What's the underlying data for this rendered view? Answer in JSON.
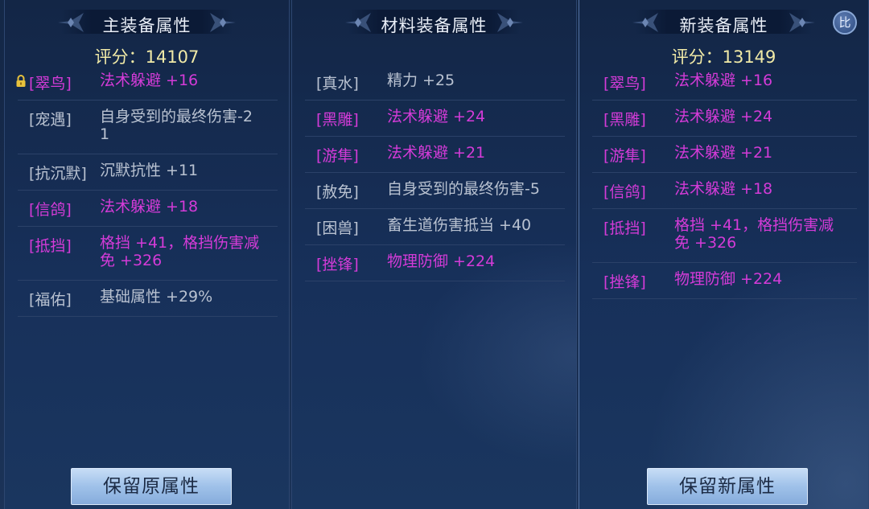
{
  "panels": {
    "main": {
      "title": "主装备属性",
      "score": "评分：14107",
      "button": "保留原属性",
      "attributes": [
        {
          "name": "[翠鸟]",
          "value": "法术躲避 +16",
          "color": "pink",
          "locked": true
        },
        {
          "name": "[宠遇]",
          "value": "自身受到的最终伤害-2\n1",
          "color": "gray"
        },
        {
          "name": "[抗沉默]",
          "value": "沉默抗性 +11",
          "color": "gray"
        },
        {
          "name": "[信鸽]",
          "value": "法术躲避 +18",
          "color": "pink"
        },
        {
          "name": "[抵挡]",
          "value": "格挡 +41，格挡伤害减\n免 +326",
          "color": "pink"
        },
        {
          "name": "[福佑]",
          "value": "基础属性 +29%",
          "color": "gray"
        }
      ]
    },
    "material": {
      "title": "材料装备属性",
      "attributes": [
        {
          "name": "[真水]",
          "value": "精力 +25",
          "color": "gray"
        },
        {
          "name": "[黑雕]",
          "value": "法术躲避 +24",
          "color": "pink"
        },
        {
          "name": "[游隼]",
          "value": "法术躲避 +21",
          "color": "pink"
        },
        {
          "name": "[赦免]",
          "value": "自身受到的最终伤害-5",
          "color": "gray"
        },
        {
          "name": "[困兽]",
          "value": "畜生道伤害抵当 +40",
          "color": "gray"
        },
        {
          "name": "[挫锋]",
          "value": "物理防御 +224",
          "color": "pink"
        }
      ]
    },
    "new": {
      "title": "新装备属性",
      "score": "评分：13149",
      "button": "保留新属性",
      "compare_label": "比",
      "attributes": [
        {
          "name": "[翠鸟]",
          "value": "法术躲避 +16",
          "color": "pink"
        },
        {
          "name": "[黑雕]",
          "value": "法术躲避 +24",
          "color": "pink"
        },
        {
          "name": "[游隼]",
          "value": "法术躲避 +21",
          "color": "pink"
        },
        {
          "name": "[信鸽]",
          "value": "法术躲避 +18",
          "color": "pink"
        },
        {
          "name": "[抵挡]",
          "value": "格挡 +41，格挡伤害减\n免 +326",
          "color": "pink"
        },
        {
          "name": "[挫锋]",
          "value": "物理防御 +224",
          "color": "pink"
        }
      ]
    }
  },
  "colors": {
    "pink": "#d43bd8",
    "gray": "#b9c2d1",
    "score": "#f1eaa7",
    "title": "#e9eef7"
  },
  "icons": {
    "lock": "lock-icon",
    "header_ornament": "ornament-icon"
  }
}
